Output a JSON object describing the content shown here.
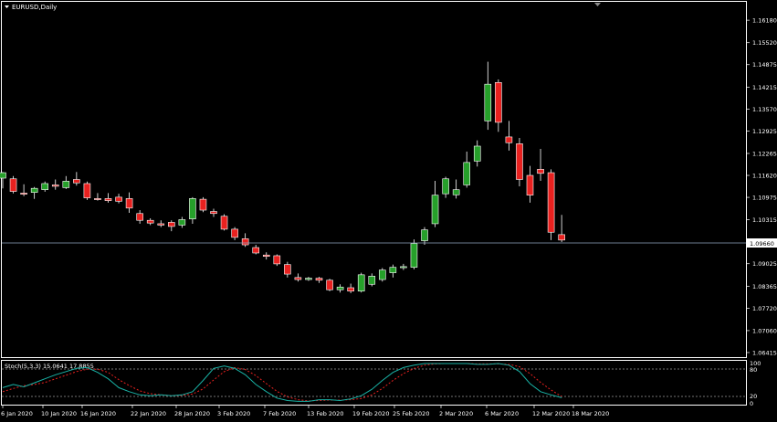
{
  "main_chart": {
    "title": "EURUSD,Daily",
    "current_price_label": "1.09660",
    "price_ticks": [
      "1.16180",
      "1.15520",
      "1.14875",
      "1.14215",
      "1.13570",
      "1.12925",
      "1.12265",
      "1.11620",
      "1.10975",
      "1.10315",
      "1.09670",
      "1.09025",
      "1.08365",
      "1.07720",
      "1.07060",
      "1.06415"
    ]
  },
  "indicator": {
    "label": "Stoch(5,3,3) 15.0641 17.8855",
    "levels": [
      "100",
      "80",
      "20",
      "0"
    ]
  },
  "time_axis": {
    "labels": [
      "6 Jan 2020",
      "10 Jan 2020",
      "16 Jan 2020",
      "22 Jan 2020",
      "28 Jan 2020",
      "3 Feb 2020",
      "7 Feb 2020",
      "13 Feb 2020",
      "19 Feb 2020",
      "25 Feb 2020",
      "2 Mar 2020",
      "6 Mar 2020",
      "12 Mar 2020",
      "18 Mar 2020"
    ]
  },
  "colors": {
    "background": "#000000",
    "bull": "#26a02a",
    "bear": "#e8211f",
    "text": "#ffffff",
    "stoch_main": "#19b3a6",
    "stoch_signal": "#e8211f",
    "price_line": "#8fa7c0"
  },
  "chart_data": {
    "type": "candlestick",
    "symbol": "EURUSD",
    "timeframe": "Daily",
    "ylim": [
      1.0628,
      1.1672
    ],
    "candles": [
      {
        "o": 1.1154,
        "h": 1.1172,
        "l": 1.1124,
        "c": 1.117
      },
      {
        "o": 1.1152,
        "h": 1.116,
        "l": 1.1109,
        "c": 1.1115
      },
      {
        "o": 1.111,
        "h": 1.1136,
        "l": 1.1101,
        "c": 1.1108
      },
      {
        "o": 1.1112,
        "h": 1.1128,
        "l": 1.1093,
        "c": 1.1124
      },
      {
        "o": 1.112,
        "h": 1.1144,
        "l": 1.1114,
        "c": 1.1138
      },
      {
        "o": 1.1134,
        "h": 1.115,
        "l": 1.112,
        "c": 1.113
      },
      {
        "o": 1.1126,
        "h": 1.116,
        "l": 1.1122,
        "c": 1.1145
      },
      {
        "o": 1.115,
        "h": 1.1172,
        "l": 1.1132,
        "c": 1.114
      },
      {
        "o": 1.1138,
        "h": 1.1144,
        "l": 1.109,
        "c": 1.1096
      },
      {
        "o": 1.1094,
        "h": 1.111,
        "l": 1.1088,
        "c": 1.1092
      },
      {
        "o": 1.1094,
        "h": 1.111,
        "l": 1.1082,
        "c": 1.1088
      },
      {
        "o": 1.1098,
        "h": 1.1108,
        "l": 1.108,
        "c": 1.1086
      },
      {
        "o": 1.1094,
        "h": 1.1112,
        "l": 1.1052,
        "c": 1.1066
      },
      {
        "o": 1.105,
        "h": 1.106,
        "l": 1.102,
        "c": 1.103
      },
      {
        "o": 1.103,
        "h": 1.1036,
        "l": 1.1016,
        "c": 1.1022
      },
      {
        "o": 1.102,
        "h": 1.103,
        "l": 1.101,
        "c": 1.1016
      },
      {
        "o": 1.1024,
        "h": 1.103,
        "l": 1.0998,
        "c": 1.1012
      },
      {
        "o": 1.1016,
        "h": 1.104,
        "l": 1.1008,
        "c": 1.1032
      },
      {
        "o": 1.1034,
        "h": 1.1098,
        "l": 1.102,
        "c": 1.1094
      },
      {
        "o": 1.1092,
        "h": 1.1098,
        "l": 1.1054,
        "c": 1.106
      },
      {
        "o": 1.1056,
        "h": 1.1064,
        "l": 1.104,
        "c": 1.105
      },
      {
        "o": 1.1042,
        "h": 1.1048,
        "l": 1.1,
        "c": 1.1004
      },
      {
        "o": 1.1004,
        "h": 1.101,
        "l": 1.0972,
        "c": 1.098
      },
      {
        "o": 1.0976,
        "h": 1.0992,
        "l": 1.0952,
        "c": 1.0958
      },
      {
        "o": 1.095,
        "h": 1.0958,
        "l": 1.093,
        "c": 1.0934
      },
      {
        "o": 1.0928,
        "h": 1.0936,
        "l": 1.0915,
        "c": 1.0924
      },
      {
        "o": 1.0926,
        "h": 1.093,
        "l": 1.0896,
        "c": 1.0902
      },
      {
        "o": 1.09,
        "h": 1.0908,
        "l": 1.0862,
        "c": 1.0872
      },
      {
        "o": 1.0862,
        "h": 1.0874,
        "l": 1.085,
        "c": 1.0856
      },
      {
        "o": 1.0856,
        "h": 1.0864,
        "l": 1.0852,
        "c": 1.086
      },
      {
        "o": 1.086,
        "h": 1.0864,
        "l": 1.0846,
        "c": 1.0854
      },
      {
        "o": 1.0854,
        "h": 1.0858,
        "l": 1.0822,
        "c": 1.0826
      },
      {
        "o": 1.0826,
        "h": 1.0842,
        "l": 1.0818,
        "c": 1.0834
      },
      {
        "o": 1.0832,
        "h": 1.0844,
        "l": 1.0816,
        "c": 1.0822
      },
      {
        "o": 1.0822,
        "h": 1.0876,
        "l": 1.0818,
        "c": 1.087
      },
      {
        "o": 1.0842,
        "h": 1.0874,
        "l": 1.0836,
        "c": 1.0866
      },
      {
        "o": 1.0856,
        "h": 1.089,
        "l": 1.085,
        "c": 1.0884
      },
      {
        "o": 1.0876,
        "h": 1.09,
        "l": 1.0862,
        "c": 1.0892
      },
      {
        "o": 1.0892,
        "h": 1.0902,
        "l": 1.0884,
        "c": 1.0894
      },
      {
        "o": 1.0892,
        "h": 1.0974,
        "l": 1.0886,
        "c": 1.0962
      },
      {
        "o": 1.097,
        "h": 1.101,
        "l": 1.0958,
        "c": 1.1002
      },
      {
        "o": 1.102,
        "h": 1.1146,
        "l": 1.101,
        "c": 1.1104
      },
      {
        "o": 1.1108,
        "h": 1.1158,
        "l": 1.1096,
        "c": 1.1152
      },
      {
        "o": 1.1105,
        "h": 1.115,
        "l": 1.1094,
        "c": 1.112
      },
      {
        "o": 1.1134,
        "h": 1.1232,
        "l": 1.1126,
        "c": 1.12
      },
      {
        "o": 1.1204,
        "h": 1.1265,
        "l": 1.1188,
        "c": 1.1248
      },
      {
        "o": 1.1322,
        "h": 1.1496,
        "l": 1.1296,
        "c": 1.143
      },
      {
        "o": 1.1435,
        "h": 1.1444,
        "l": 1.129,
        "c": 1.1318
      },
      {
        "o": 1.1275,
        "h": 1.1322,
        "l": 1.1235,
        "c": 1.1258
      },
      {
        "o": 1.1255,
        "h": 1.1272,
        "l": 1.113,
        "c": 1.115
      },
      {
        "o": 1.1162,
        "h": 1.119,
        "l": 1.1082,
        "c": 1.1104
      },
      {
        "o": 1.118,
        "h": 1.124,
        "l": 1.1146,
        "c": 1.1168
      },
      {
        "o": 1.117,
        "h": 1.118,
        "l": 1.0972,
        "c": 1.0995
      },
      {
        "o": 1.0988,
        "h": 1.1046,
        "l": 1.0966,
        "c": 1.0972
      }
    ],
    "stochastic": {
      "params": "5,3,3",
      "main": [
        40,
        48,
        42,
        52,
        62,
        72,
        80,
        88,
        90,
        78,
        62,
        40,
        30,
        22,
        20,
        22,
        20,
        22,
        30,
        58,
        88,
        94,
        88,
        72,
        48,
        30,
        14,
        8,
        6,
        6,
        10,
        10,
        8,
        12,
        20,
        36,
        58,
        78,
        90,
        96,
        100,
        100,
        100,
        100,
        100,
        98,
        98,
        100,
        96,
        80,
        50,
        30,
        22,
        15
      ],
      "signal": [
        30,
        38,
        45,
        48,
        53,
        62,
        71,
        80,
        86,
        86,
        78,
        60,
        45,
        32,
        25,
        22,
        20,
        21,
        24,
        37,
        59,
        80,
        90,
        85,
        70,
        50,
        31,
        17,
        10,
        7,
        8,
        9,
        9,
        10,
        13,
        22,
        38,
        58,
        75,
        88,
        96,
        99,
        100,
        100,
        100,
        99,
        99,
        99,
        98,
        92,
        75,
        53,
        34,
        18
      ]
    }
  }
}
